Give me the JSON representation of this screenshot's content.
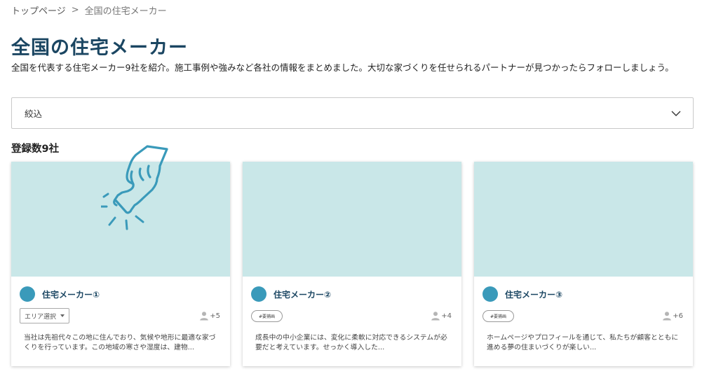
{
  "breadcrumb": {
    "home": "トップページ",
    "separator": ">",
    "current": "全国の住宅メーカー"
  },
  "page": {
    "title": "全国の住宅メーカー",
    "description": "全国を代表する住宅メーカー9社を紹介。施工事例や強みなど各社の情報をまとめました。大切な家づくりを任せられるパートナーが見つかったらフォローしましょう。"
  },
  "filter": {
    "label": "絞込",
    "icon": "chevron-down-icon"
  },
  "count_label": "登録数9社",
  "colors": {
    "accent": "#1b4662",
    "avatar": "#3a9aba",
    "thumb": "#c9e7e8",
    "hand": "#3a9aba"
  },
  "cards": [
    {
      "name": "住宅メーカー①",
      "control_type": "select",
      "control_label": "エリア選択",
      "followers": "+5",
      "description": "当社は先祖代々この地に住んでおり、気候や地形に最適な家づくりを行っています。この地域の寒さや湿度は、建物..."
    },
    {
      "name": "住宅メーカー②",
      "control_type": "tag",
      "control_label": "#要捕画",
      "followers": "+4",
      "description": "成長中の中小企業には、変化に柔軟に対応できるシステムが必要だと考えています。せっかく導入した..."
    },
    {
      "name": "住宅メーカー③",
      "control_type": "tag",
      "control_label": "#要捕画",
      "followers": "+6",
      "description": "ホームページやプロフィールを通じて、私たちが顧客とともに進める夢の住まいづくりが楽しい..."
    }
  ]
}
